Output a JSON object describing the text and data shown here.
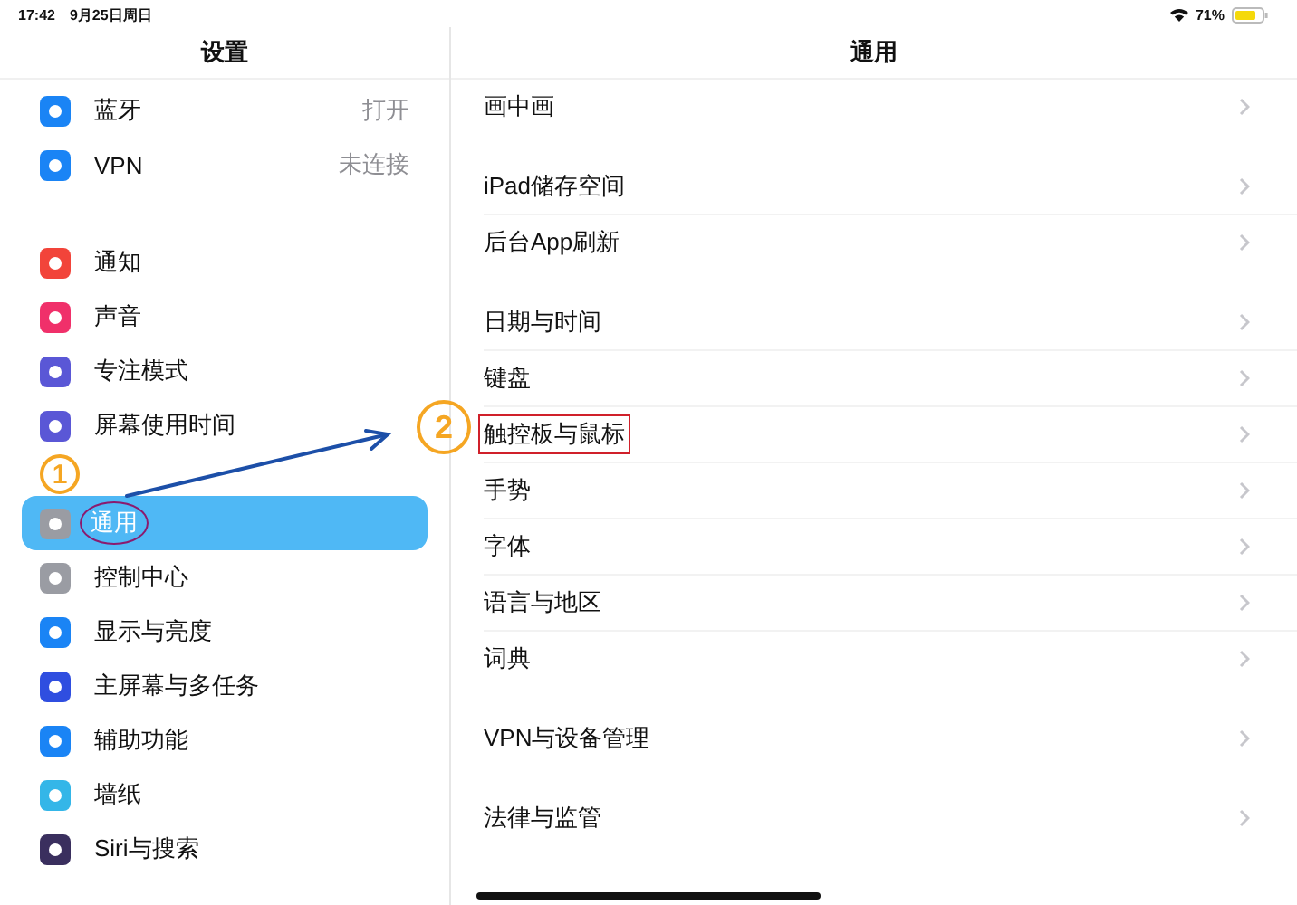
{
  "status_bar": {
    "time": "17:42",
    "date": "9月25日周日",
    "battery": "71%"
  },
  "sidebar": {
    "title": "设置",
    "groups": [
      [
        {
          "label": "蓝牙",
          "value": "打开",
          "color": "#1a84f5",
          "selected": false,
          "circled": false
        },
        {
          "label": "VPN",
          "value": "未连接",
          "color": "#1a84f5",
          "selected": false,
          "circled": false
        }
      ],
      [
        {
          "label": "通知",
          "color": "#f2443a",
          "selected": false,
          "circled": false
        },
        {
          "label": "声音",
          "color": "#f0306a",
          "selected": false,
          "circled": false
        },
        {
          "label": "专注模式",
          "color": "#5a57d6",
          "selected": false,
          "circled": false
        },
        {
          "label": "屏幕使用时间",
          "color": "#5a57d6",
          "selected": false,
          "circled": false
        }
      ],
      [
        {
          "label": "通用",
          "color": "#9a9ca3",
          "selected": true,
          "circled": true
        },
        {
          "label": "控制中心",
          "color": "#9a9ca3",
          "selected": false,
          "circled": false
        },
        {
          "label": "显示与亮度",
          "color": "#1a84f5",
          "selected": false,
          "circled": false
        },
        {
          "label": "主屏幕与多任务",
          "color": "#2f4ee0",
          "selected": false,
          "circled": false
        },
        {
          "label": "辅助功能",
          "color": "#1a84f5",
          "selected": false,
          "circled": false
        },
        {
          "label": "墙纸",
          "color": "#34b6e8",
          "selected": false,
          "circled": false
        },
        {
          "label": "Siri与搜索",
          "color": "#3a2f5e",
          "selected": false,
          "circled": false
        }
      ]
    ]
  },
  "detail": {
    "title": "通用",
    "groups": [
      [
        {
          "label": "画中画",
          "highlighted": false
        }
      ],
      [
        {
          "label": "iPad储存空间",
          "highlighted": false
        },
        {
          "label": "后台App刷新",
          "highlighted": false
        }
      ],
      [
        {
          "label": "日期与时间",
          "highlighted": false
        },
        {
          "label": "键盘",
          "highlighted": false
        },
        {
          "label": "触控板与鼠标",
          "highlighted": true
        },
        {
          "label": "手势",
          "highlighted": false
        },
        {
          "label": "字体",
          "highlighted": false
        },
        {
          "label": "语言与地区",
          "highlighted": false
        },
        {
          "label": "词典",
          "highlighted": false
        }
      ],
      [
        {
          "label": "VPN与设备管理",
          "highlighted": false
        }
      ],
      [
        {
          "label": "法律与监管",
          "highlighted": false
        }
      ]
    ]
  },
  "annotations": [
    {
      "label": "1"
    },
    {
      "label": "2"
    }
  ]
}
